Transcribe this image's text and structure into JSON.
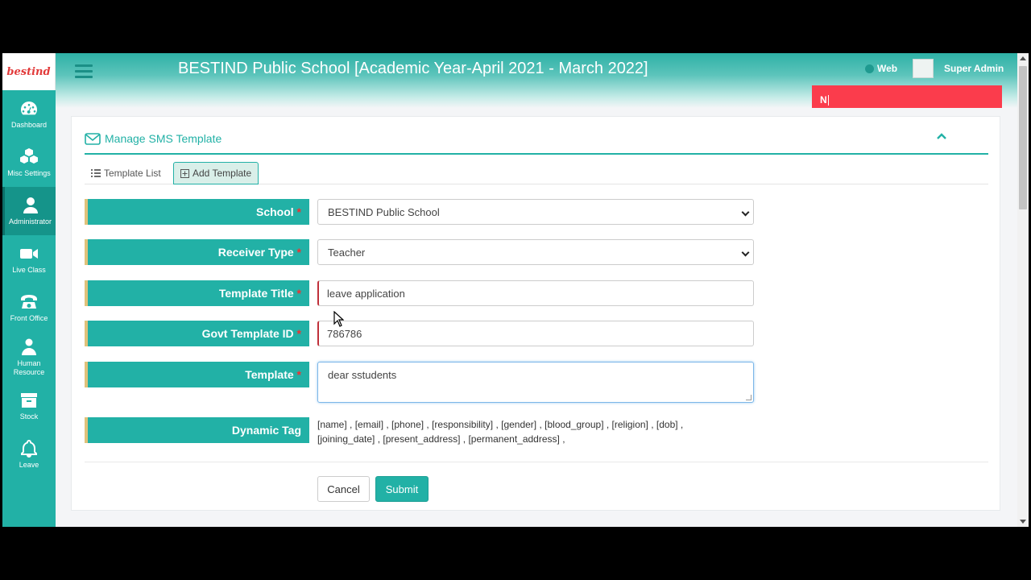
{
  "brand": {
    "logo_text": "bestind"
  },
  "sidebar": {
    "items": [
      {
        "label": "Dashboard",
        "icon": "gauge-icon"
      },
      {
        "label": "Misc Settings",
        "icon": "cubes-icon"
      },
      {
        "label": "Administrator",
        "icon": "user-icon",
        "active": true
      },
      {
        "label": "Live Class",
        "icon": "video-icon"
      },
      {
        "label": "Front Office",
        "icon": "phone-icon"
      },
      {
        "label": "Human Resource",
        "icon": "user-md-icon"
      },
      {
        "label": "Stock",
        "icon": "archive-icon"
      },
      {
        "label": "Leave",
        "icon": "bell-icon"
      }
    ]
  },
  "header": {
    "title": "BESTIND Public School [Academic Year-April 2021 - March 2022]",
    "web_label": "Web",
    "user_name": "Super Admin",
    "notification_text": "N"
  },
  "panel": {
    "title": "Manage SMS Template",
    "tabs": {
      "list": "Template List",
      "add": "Add Template"
    }
  },
  "form": {
    "school": {
      "label": "School",
      "required": "*",
      "value": "BESTIND Public School"
    },
    "receiver_type": {
      "label": "Receiver Type",
      "required": "*",
      "value": "Teacher"
    },
    "template_title": {
      "label": "Template Title",
      "required": "*",
      "value": "leave application"
    },
    "govt_template_id": {
      "label": "Govt Template ID",
      "required": "*",
      "value": "786786"
    },
    "template": {
      "label": "Template",
      "required": "*",
      "value": "dear sstudents"
    },
    "dynamic_tag": {
      "label": "Dynamic Tag",
      "line1": "[name] ,  [email] ,  [phone] ,  [responsibility] ,  [gender] ,  [blood_group] ,  [religion] ,  [dob] ,",
      "line2": "[joining_date] ,  [present_address] ,  [permanent_address] ,"
    },
    "cancel_label": "Cancel",
    "submit_label": "Submit"
  },
  "colors": {
    "accent": "#22b1a6",
    "notify": "#fb3c4c",
    "label_border": "#e0c27a"
  }
}
